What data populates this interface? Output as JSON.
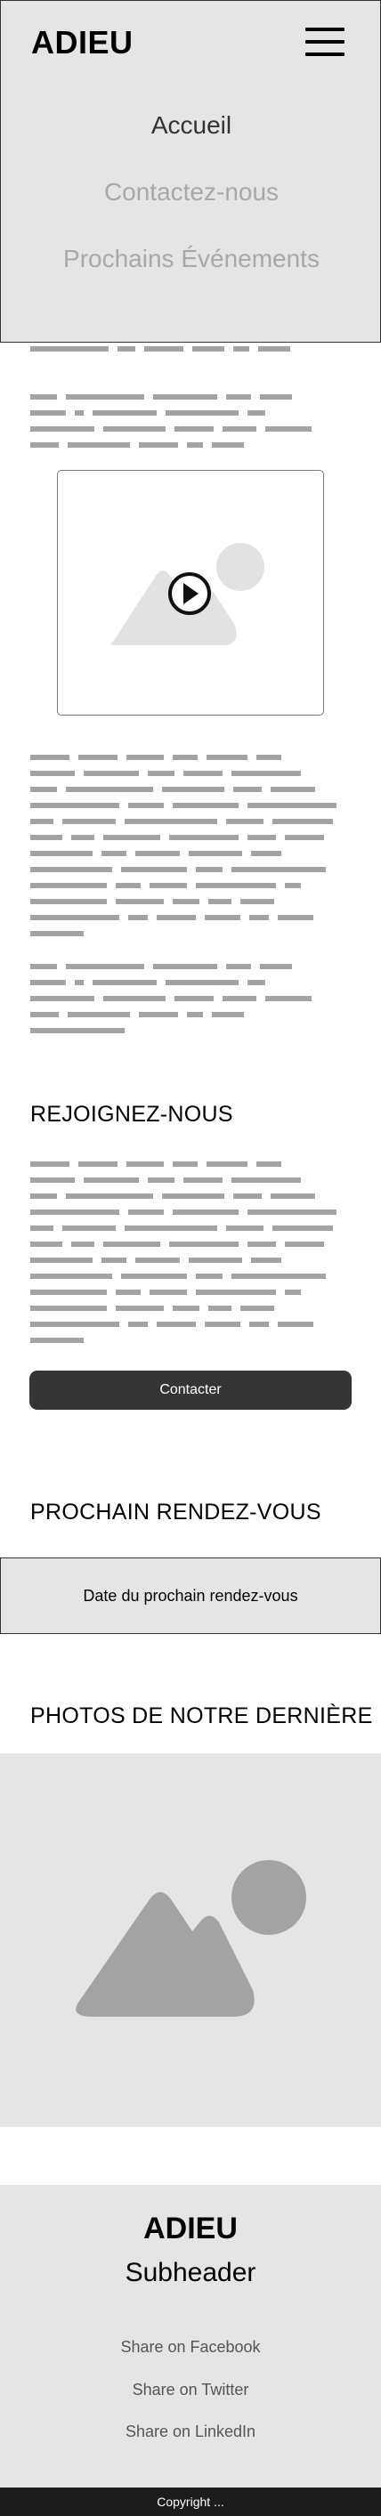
{
  "header": {
    "logo": "ADIEU",
    "menu_icon": "hamburger-menu-icon",
    "nav": [
      {
        "label": "Accueil",
        "active": true
      },
      {
        "label": "Contactez-nous",
        "active": false
      },
      {
        "label": "Prochains Événements",
        "active": false
      }
    ]
  },
  "video": {
    "icon": "play-icon",
    "placeholder_icon": "image-placeholder-icon"
  },
  "join": {
    "title": "REJOIGNEZ-NOUS",
    "button_label": "Contacter"
  },
  "next_meeting": {
    "title": "PROCHAIN RENDEZ-VOUS",
    "date_text": "Date du prochain rendez-vous"
  },
  "photos": {
    "title": "PHOTOS DE NOTRE DERNIÈRE",
    "placeholder_icon": "image-placeholder-icon"
  },
  "footer": {
    "title": "ADIEU",
    "subheader": "Subheader",
    "links": [
      "Share on Facebook",
      "Share on Twitter",
      "Share on LinkedIn"
    ],
    "copyright": "Copyright ..."
  },
  "colors": {
    "menu_bg": "#e5e5e5",
    "button_bg": "#353535",
    "placeholder_line": "#a3a3a3",
    "nav_inactive": "#a8a8a8",
    "copyright_bg": "#1c1c1c"
  }
}
